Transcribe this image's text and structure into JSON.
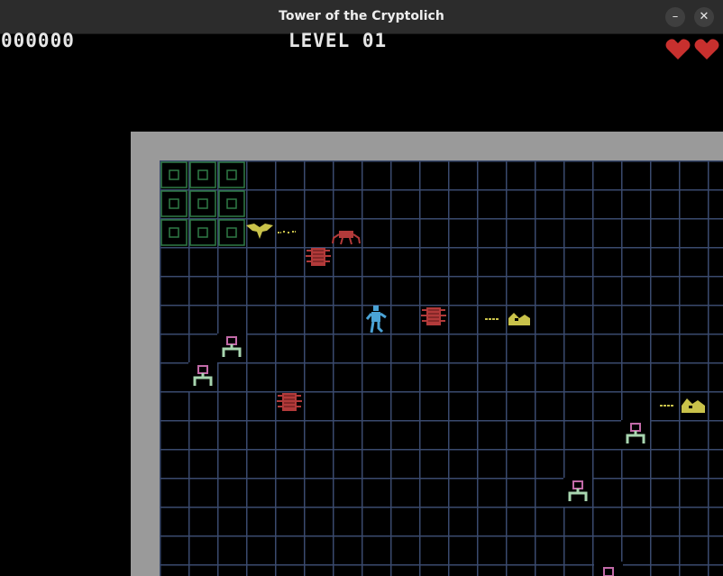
{
  "window": {
    "title": "Tower of the Cryptolich",
    "minimize_glyph": "–",
    "close_glyph": "✕"
  },
  "hud": {
    "score": "000000",
    "level": "LEVEL 01",
    "lives": 2
  },
  "colors": {
    "wall": "#9a9a9a",
    "grid": "#3a4a6e",
    "floor": "#000000",
    "heart": "#c8302e",
    "spawner": "#2f7a45",
    "spider": "#b23a3a",
    "beetle": "#b23a3a",
    "wraith": "#c9c24a",
    "player": "#4aa3d6",
    "turret_body": "#c26aa8",
    "turret_base": "#a8d6b0"
  },
  "sprites": {
    "spawners": "tomb-spawner",
    "player": "player-hero",
    "enemies": [
      "bat-wraith",
      "red-spider",
      "red-beetle",
      "yellow-serpent",
      "crypt-turret"
    ]
  }
}
